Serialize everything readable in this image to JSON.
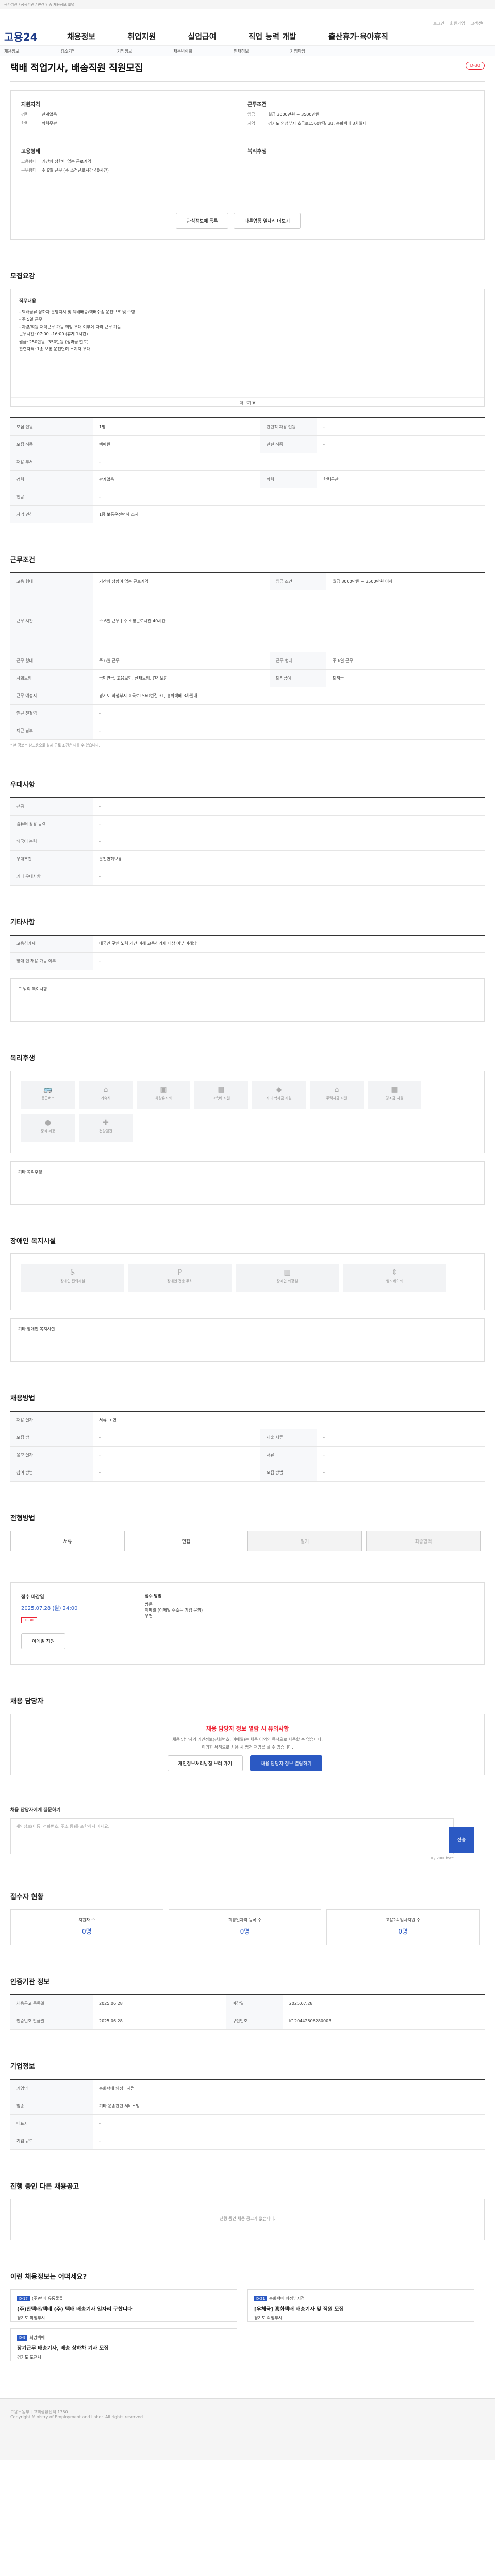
{
  "topbar": "국가기관 / 공공기관 / 민간 인증 채용정보 포털",
  "header": {
    "logo": "고용24",
    "util": [
      "로그인",
      "회원가입",
      "고객센터"
    ],
    "gnb": [
      "채용정보",
      "취업지원",
      "실업급여",
      "직업 능력 개발",
      "출산휴가·육아휴직"
    ],
    "lnb": [
      "채용정보",
      "강소기업",
      "기업정보",
      "채용박람회",
      "인재정보",
      "기업마당"
    ]
  },
  "title": {
    "heading": "택배 적업기사, 배송직원 직원모집",
    "tag": "D-30"
  },
  "summary": {
    "left": {
      "k1": "지원자격",
      "rows1": [
        {
          "k": "경력",
          "v": "관계없음"
        },
        {
          "k": "학력",
          "v": "학력무관"
        }
      ],
      "k2": "고용형태",
      "rows2": [
        {
          "k": "고용형태",
          "v": "기간의 정함이 없는 근로계약"
        },
        {
          "k": "근무형태",
          "v": "주 6일 근무 (주 소정근로시간 40시간)"
        }
      ]
    },
    "right": {
      "k1": "근무조건",
      "rows1": [
        {
          "k": "임금",
          "v": "월급 3000만원 ~ 3500만원"
        },
        {
          "k": "지역",
          "v": "경기도 의정부시 호국로1560번길 31, 흥화택배 3차일대"
        }
      ],
      "k2": "복리후생",
      "rows2": []
    },
    "btn_apply": "관심정보에 등록",
    "btn_more": "다른업종 일자리 더보기"
  },
  "recruit": {
    "title": "모집요강",
    "desc_label": "직무내용",
    "desc_lines": [
      "- 택배물류 상하차 운영지시 및 택배배송/택배수송 운전보조 및 수행",
      "- 주 5일 근무",
      "- 차량/직원 재택근무 가능 희망 우대 여부에 따라 근무 가능",
      "근무시간: 07:00~16:00 (휴게 1시간)",
      "월급: 250만원~350만원 (성과급 별도)",
      "관련자격: 1종 보통 운전면허 소지자 우대"
    ],
    "fold": "더보기 ▼",
    "rows": [
      {
        "k": "모집 인원",
        "v": "1명",
        "k2": "관련직 채용 인원",
        "v2": "-"
      },
      {
        "k": "모집 직종",
        "v": "택배원",
        "k2": "관련 직종",
        "v2": "-"
      },
      {
        "k": "채용 부서",
        "v": "-",
        "k2": "",
        "v2": ""
      },
      {
        "k": "경력",
        "v": "관계없음",
        "k2": "학력",
        "v2": "학력무관"
      },
      {
        "k": "전공",
        "v": "-",
        "k2": "",
        "v2": ""
      },
      {
        "k": "자격 면허",
        "v": "1종 보통운전면허 소지",
        "k2": "",
        "v2": ""
      }
    ]
  },
  "work": {
    "title": "근무조건",
    "rows": [
      {
        "k": "고용 형태",
        "v": "기간의 정함이 없는 근로계약",
        "k2": "임금 조건",
        "v2": "월급 3000만원 ~ 3500만원 이하"
      },
      {
        "k": "근무 시간",
        "v": "주 6일 근무 | 주 소정근로시간 40시간",
        "k2": "",
        "v2": ""
      },
      {
        "k": "근무 형태",
        "v": "주 6일 근무",
        "k2": "근무 형태",
        "v2": "주 6일 근무"
      },
      {
        "k": "사회보험",
        "v": "국민연금, 고용보험, 산재보험, 건강보험",
        "k2": "퇴직금여",
        "v2": "퇴직금"
      },
      {
        "k": "근무 예정지",
        "v": "경기도 의정부시 호국로1560번길 31, 흥화택배 3차일대",
        "k2": "",
        "v2": ""
      },
      {
        "k": "인근 전철역",
        "v": "-",
        "k2": "",
        "v2": ""
      },
      {
        "k": "퇴근 남부",
        "v": "-",
        "k2": "",
        "v2": ""
      }
    ],
    "note": "* 본 정보는 참고용으로 실제 근로 조건은 다를 수 있습니다."
  },
  "prefer": {
    "title": "우대사항",
    "rows": [
      {
        "k": "전공",
        "v": "-"
      },
      {
        "k": "컴퓨터 활용 능력",
        "v": "-"
      },
      {
        "k": "외국어 능력",
        "v": "-"
      },
      {
        "k": "우대조건",
        "v": "운전면허보유"
      },
      {
        "k": "기타 우대사항",
        "v": "-"
      }
    ]
  },
  "etc": {
    "title": "기타사항",
    "rows": [
      {
        "k": "고용허가제",
        "v": "내국인 구인 노력 기간 미해 고용허가제 대상 여부 미해당"
      },
      {
        "k": "장애 인 채용 가능 여부",
        "v": "-"
      }
    ],
    "box_label": "그 밖의 특이사항"
  },
  "welfare": {
    "title": "복리후생",
    "icons": [
      "통근버스",
      "기숙사",
      "차량유지비",
      "교육비 지원",
      "자녀 학자금 지원",
      "주택자금 지원",
      "경조금 지원",
      "중식 제공",
      "건강검진"
    ],
    "box_label": "기타 복리후생"
  },
  "disability": {
    "title": "장애인 복지시설",
    "icons": [
      "장애인 편의시설",
      "장애인 전용 주차",
      "장애인 화장실",
      "엘리베이터"
    ],
    "box_label": "기타 장애인 복지시설"
  },
  "apply_method": {
    "title": "채용방법",
    "rows": [
      {
        "k": "채용 절차",
        "v": "서류 → 면"
      },
      {
        "k": "모집 방",
        "v": "-",
        "k2": "제출 서류",
        "v2": "-"
      },
      {
        "k": "응모 절차",
        "v": "-",
        "k2": "서류",
        "v2": "-"
      },
      {
        "k": "참여 방법",
        "v": "-",
        "k2": "모집 방법",
        "v2": "-"
      }
    ]
  },
  "process": {
    "title": "전형방법",
    "steps": [
      "서류",
      "면접",
      "필기",
      "최종합격"
    ]
  },
  "deadline": {
    "title": "접수 마감일",
    "date": "2025.07.28 (월) 24:00",
    "method_label": "접수 방법",
    "methods": [
      "방문",
      "이메일 (이메일 주소는 기업 문의)",
      "우편"
    ],
    "tag": "D-30",
    "btn": "이메일 지원"
  },
  "notice": {
    "title": "채용 담당자",
    "big": "채용 담당자 정보 열람 시 유의사항",
    "lines": [
      "채용 담당자의 개인정보(전화번호, 이메일)는 채용 이외의 목적으로 사용할 수 없습니다.",
      "이러한 목적으로 사용 시 법적 책임을 질 수 있습니다."
    ],
    "btn1": "개인정보처리방침 보러 가기",
    "btn2": "채용 담당자 정보 열람하기"
  },
  "inquiry": {
    "label": "채용 담당자에게 질문하기",
    "placeholder": "개인정보(이름, 전화번호, 주소 등)를 포함하지 마세요.",
    "send": "전송",
    "count": "0 / 2000byte"
  },
  "status": {
    "title": "접수자 현황",
    "items": [
      {
        "k": "지원자 수",
        "v": "0명"
      },
      {
        "k": "희망일자리 등록 수",
        "v": "0명"
      },
      {
        "k": "고용24 입사지원 수",
        "v": "0명"
      }
    ]
  },
  "info": {
    "title": "인증기관 정보",
    "rows": [
      {
        "k": "채용공고 등록일",
        "v": "2025.06.28",
        "k2": "마감일",
        "v2": "2025.07.28"
      },
      {
        "k": "인증번호 발급일",
        "v": "2025.06.28",
        "k2": "구인번호",
        "v2": "K120442506280003"
      }
    ]
  },
  "company": {
    "title": "기업정보",
    "rows": [
      {
        "k": "기업명",
        "v": "흥화택배 의정부지점"
      },
      {
        "k": "업종",
        "v": "기타 운송관련 서비스업"
      },
      {
        "k": "대표자",
        "v": "-"
      },
      {
        "k": "기업 규모",
        "v": "-"
      }
    ]
  },
  "similar": {
    "title": "진행 중인 다른 채용공고",
    "empty": "진행 중인 채용 공고가 없습니다."
  },
  "recommend": {
    "title": "이런 채용정보는 어떠세요?",
    "cards": [
      {
        "badge": "D-17",
        "org": "(주)택배 유통물류",
        "t": "(주)찬택배/택배 (주) 택배 배송기사 일자리 구합니다",
        "loc": "경기도 의정부시"
      },
      {
        "badge": "D-21",
        "org": "흥화택배 의정부지점",
        "t": "[우체국] 흥화택배 배송기사 및 직원 모집",
        "loc": "경기도 의정부시"
      },
      {
        "badge": "D-9",
        "org": "희망택배",
        "t": "장기근무 배송기사, 배송 상하차 기사 모집",
        "loc": "경기도 포천시"
      }
    ]
  },
  "footer": {
    "lines": [
      "고용노동부 | 고객상담센터 1350",
      "Copyright Ministry of Employment and Labor. All rights reserved."
    ]
  }
}
